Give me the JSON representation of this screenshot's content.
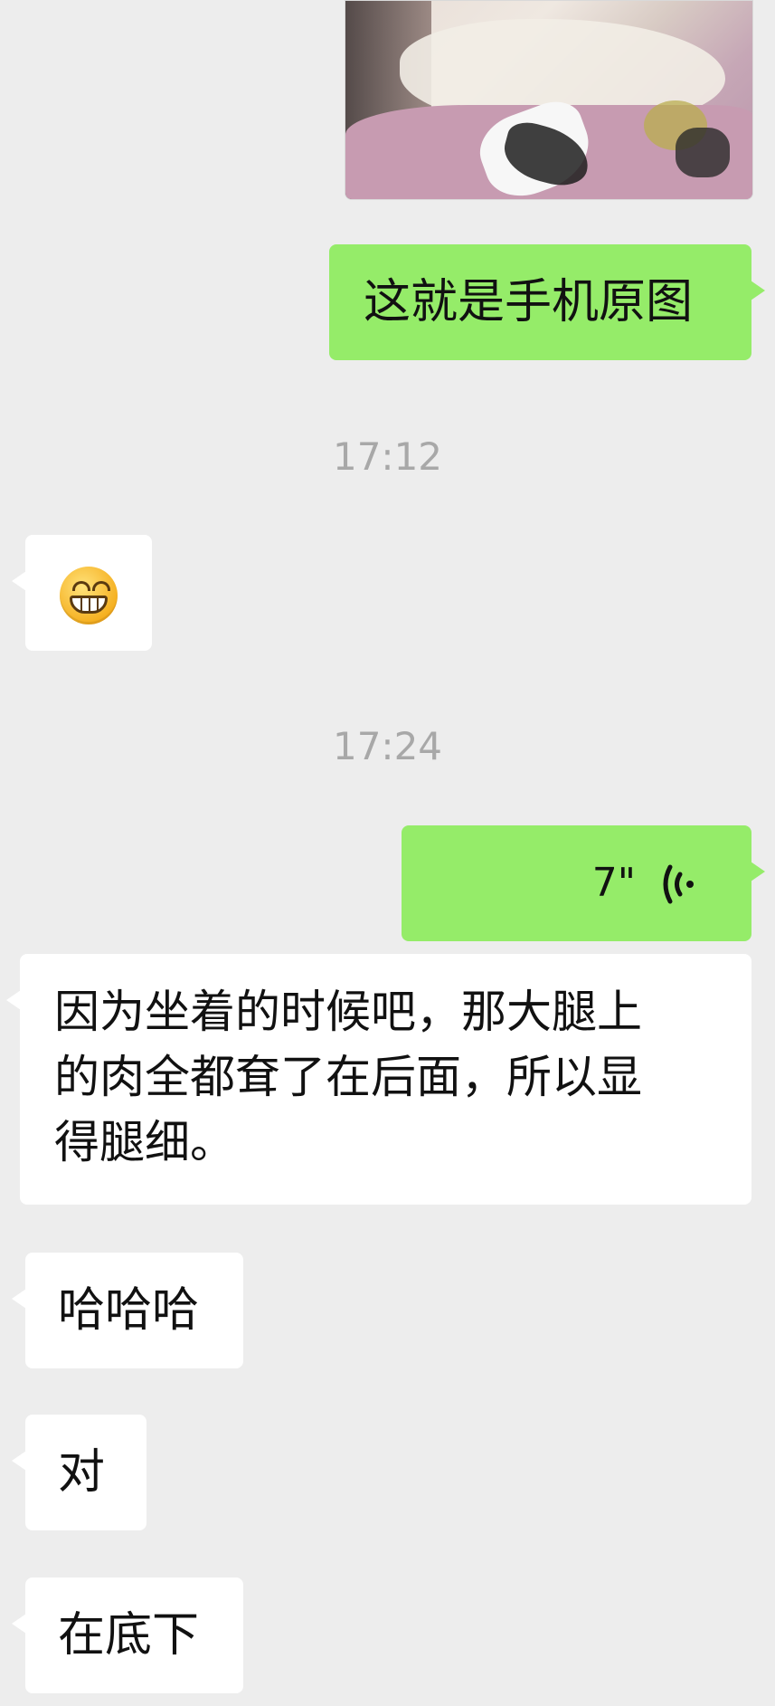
{
  "messages": {
    "m1_text": "这就是手机原图",
    "time1": "17:12",
    "m2_emoji": "grinning-face-emoji",
    "time2": "17:24",
    "m3_voice_duration": "7\"",
    "m4_text_line1": "因为坐着的时候吧，那大腿上",
    "m4_text_line2": "的肉全都耷了在后面，所以显",
    "m4_text_line3": "得腿细。",
    "m5_text": "哈哈哈",
    "m6_text": "对",
    "m7_text": "在底下"
  },
  "colors": {
    "background": "#ededed",
    "sent_bubble": "#95ec69",
    "received_bubble": "#ffffff",
    "timestamp": "#a8a8a8"
  }
}
